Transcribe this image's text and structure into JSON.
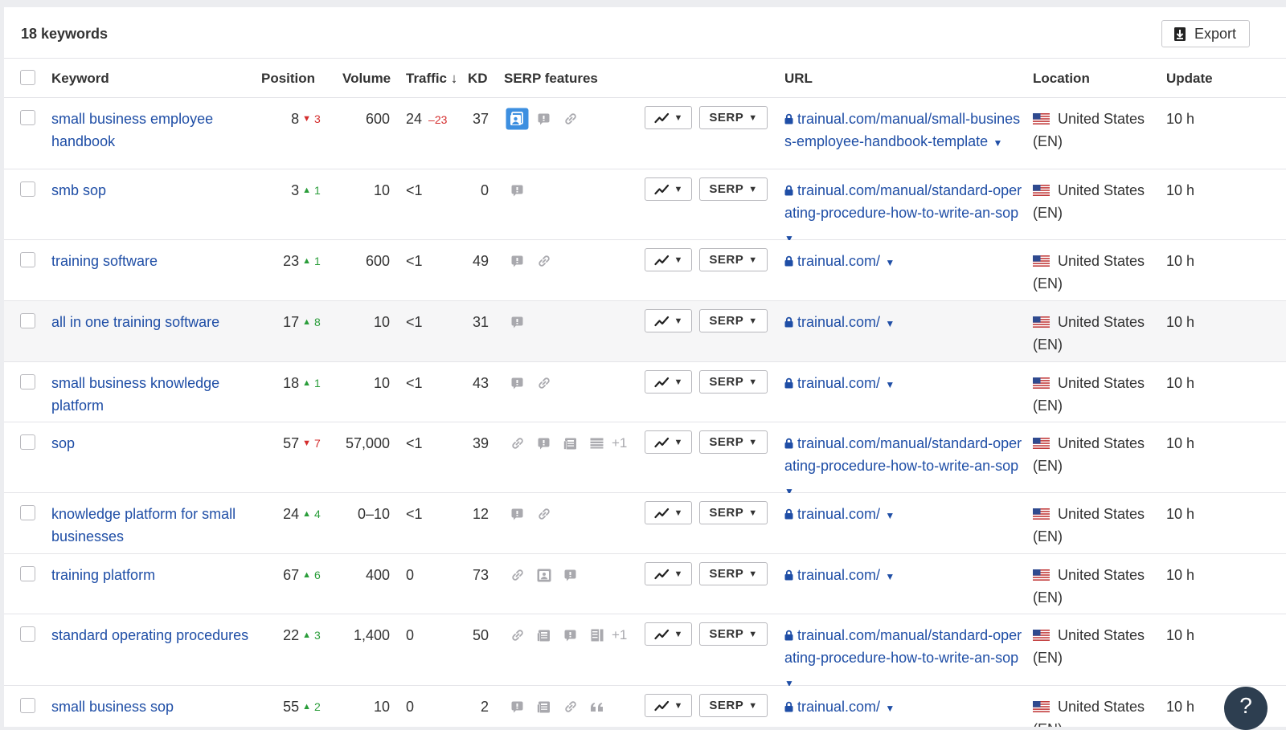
{
  "header": {
    "title": "18 keywords",
    "export_label": "Export"
  },
  "columns": {
    "keyword": "Keyword",
    "position": "Position",
    "volume": "Volume",
    "traffic": "Traffic ↓",
    "kd": "KD",
    "serp_features": "SERP features",
    "url": "URL",
    "location": "Location",
    "update": "Update"
  },
  "buttons": {
    "serp": "SERP"
  },
  "rows": [
    {
      "keyword": "small business employee handbook",
      "position": "8",
      "dir": "down",
      "change": "3",
      "volume": "600",
      "traffic": "24",
      "traffic_change": "–23",
      "kd": "37",
      "features": [
        "image-pack-active",
        "snippet",
        "link"
      ],
      "more": "",
      "url": "trainual.com/manual/small-business-employee-handbook-template",
      "location": "United States",
      "lang": "(EN)",
      "update": "10 h"
    },
    {
      "keyword": "smb sop",
      "position": "3",
      "dir": "up",
      "change": "1",
      "volume": "10",
      "traffic": "<1",
      "traffic_change": "",
      "kd": "0",
      "features": [
        "snippet"
      ],
      "more": "",
      "url": "trainual.com/manual/standard-operating-procedure-how-to-write-an-sop",
      "location": "United States",
      "lang": "(EN)",
      "update": "10 h"
    },
    {
      "keyword": "training software",
      "position": "23",
      "dir": "up",
      "change": "1",
      "volume": "600",
      "traffic": "<1",
      "traffic_change": "",
      "kd": "49",
      "features": [
        "snippet",
        "link"
      ],
      "more": "",
      "url": "trainual.com/",
      "location": "United States",
      "lang": "(EN)",
      "update": "10 h"
    },
    {
      "keyword": "all in one training software",
      "position": "17",
      "dir": "up",
      "change": "8",
      "volume": "10",
      "traffic": "<1",
      "traffic_change": "",
      "kd": "31",
      "features": [
        "snippet"
      ],
      "more": "",
      "url": "trainual.com/",
      "location": "United States",
      "lang": "(EN)",
      "update": "10 h"
    },
    {
      "keyword": "small business knowledge platform",
      "position": "18",
      "dir": "up",
      "change": "1",
      "volume": "10",
      "traffic": "<1",
      "traffic_change": "",
      "kd": "43",
      "features": [
        "snippet",
        "link"
      ],
      "more": "",
      "url": "trainual.com/",
      "location": "United States",
      "lang": "(EN)",
      "update": "10 h"
    },
    {
      "keyword": "sop",
      "position": "57",
      "dir": "down",
      "change": "7",
      "volume": "57,000",
      "traffic": "<1",
      "traffic_change": "",
      "kd": "39",
      "features": [
        "link",
        "snippet",
        "news",
        "table"
      ],
      "more": "+1",
      "url": "trainual.com/manual/standard-operating-procedure-how-to-write-an-sop",
      "location": "United States",
      "lang": "(EN)",
      "update": "10 h"
    },
    {
      "keyword": "knowledge platform for small businesses",
      "position": "24",
      "dir": "up",
      "change": "4",
      "volume": "0–10",
      "traffic": "<1",
      "traffic_change": "",
      "kd": "12",
      "features": [
        "snippet",
        "link"
      ],
      "more": "",
      "url": "trainual.com/",
      "location": "United States",
      "lang": "(EN)",
      "update": "10 h"
    },
    {
      "keyword": "training platform",
      "position": "67",
      "dir": "up",
      "change": "6",
      "volume": "400",
      "traffic": "0",
      "traffic_change": "",
      "kd": "73",
      "features": [
        "link",
        "image",
        "snippet"
      ],
      "more": "",
      "url": "trainual.com/",
      "location": "United States",
      "lang": "(EN)",
      "update": "10 h"
    },
    {
      "keyword": "standard operating procedures",
      "position": "22",
      "dir": "up",
      "change": "3",
      "volume": "1,400",
      "traffic": "0",
      "traffic_change": "",
      "kd": "50",
      "features": [
        "link",
        "news",
        "snippet",
        "sitelinks"
      ],
      "more": "+1",
      "url": "trainual.com/manual/standard-operating-procedure-how-to-write-an-sop",
      "location": "United States",
      "lang": "(EN)",
      "update": "10 h"
    },
    {
      "keyword": "small business sop",
      "position": "55",
      "dir": "up",
      "change": "2",
      "volume": "10",
      "traffic": "0",
      "traffic_change": "",
      "kd": "2",
      "features": [
        "snippet",
        "news",
        "link",
        "quote"
      ],
      "more": "",
      "url": "trainual.com/",
      "location": "United States",
      "lang": "(EN)",
      "update": "10 h"
    }
  ],
  "colors": {
    "link": "#1f4ea6",
    "up": "#2a9d3a",
    "down": "#d42d2d",
    "active_icon": "#3d8fe0"
  },
  "help": "?"
}
